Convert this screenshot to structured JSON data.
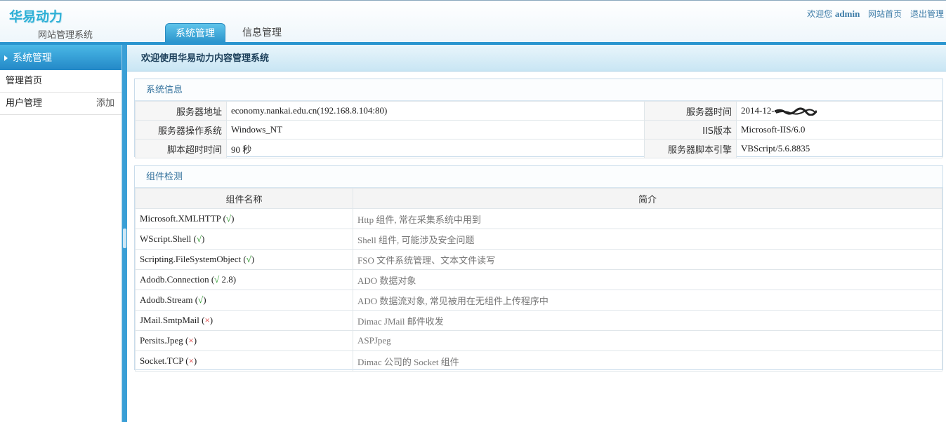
{
  "header": {
    "logo": "华易动力",
    "subtitle": "网站管理系统",
    "tabs": [
      {
        "label": "系统管理"
      },
      {
        "label": "信息管理"
      }
    ],
    "welcome": "欢迎您",
    "user": "admin",
    "home_link": "网站首页",
    "logout_link": "退出管理"
  },
  "sidebar": {
    "title": "系统管理",
    "items": [
      {
        "label": "管理首页"
      },
      {
        "label": "用户管理",
        "action": "添加"
      }
    ]
  },
  "main": {
    "title": "欢迎使用华易动力内容管理系统",
    "sysinfo": {
      "title": "系统信息",
      "rows": [
        {
          "l1": "服务器地址",
          "v1": "economy.nankai.edu.cn(192.168.8.104:80)",
          "l2": "服务器时间",
          "v2": "2014-12-"
        },
        {
          "l1": "服务器操作系统",
          "v1": "Windows_NT",
          "l2": "IIS版本",
          "v2": "Microsoft-IIS/6.0"
        },
        {
          "l1": "脚本超时时间",
          "v1": "90 秒",
          "l2": "服务器脚本引擎",
          "v2": "VBScript/5.6.8835"
        }
      ]
    },
    "components": {
      "title": "组件检测",
      "col_name": "组件名称",
      "col_desc": "简介",
      "rows": [
        {
          "name": "Microsoft.XMLHTTP (",
          "mark": "√",
          "status": "ok",
          "suffix": ")",
          "desc": "Http 组件, 常在采集系统中用到"
        },
        {
          "name": "WScript.Shell (",
          "mark": "√",
          "status": "ok",
          "suffix": ")",
          "desc": "Shell 组件, 可能涉及安全问题"
        },
        {
          "name": "Scripting.FileSystemObject (",
          "mark": "√",
          "status": "ok",
          "suffix": ")",
          "desc": "FSO 文件系统管理、文本文件读写"
        },
        {
          "name": "Adodb.Connection (",
          "mark": "√",
          "status": "ok",
          "suffix": " 2.8)",
          "desc": "ADO 数据对象"
        },
        {
          "name": "Adodb.Stream (",
          "mark": "√",
          "status": "ok",
          "suffix": ")",
          "desc": "ADO 数据流对象, 常见被用在无组件上传程序中"
        },
        {
          "name": "JMail.SmtpMail (",
          "mark": "×",
          "status": "bad",
          "suffix": ")",
          "desc": "Dimac JMail 邮件收发"
        },
        {
          "name": "Persits.Jpeg (",
          "mark": "×",
          "status": "bad",
          "suffix": ")",
          "desc": "ASPJpeg"
        },
        {
          "name": "Socket.TCP (",
          "mark": "×",
          "status": "bad",
          "suffix": ")",
          "desc": "Dimac 公司的 Socket 组件"
        }
      ]
    }
  }
}
